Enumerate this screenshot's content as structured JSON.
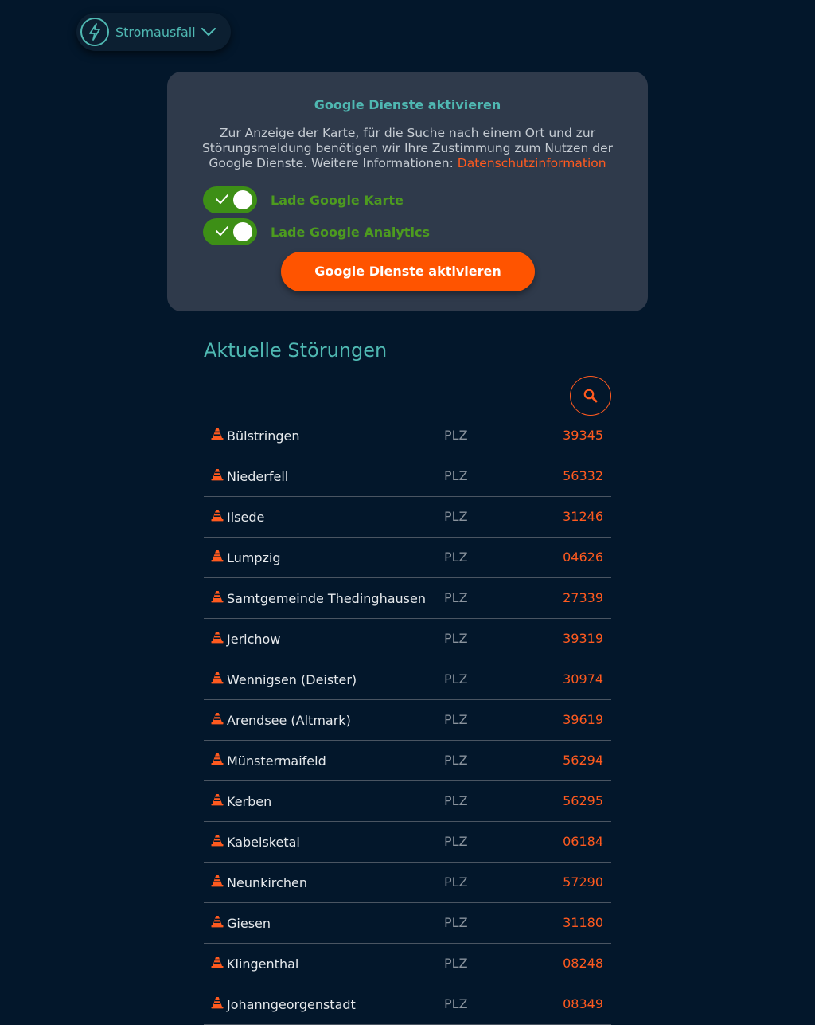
{
  "nav": {
    "selector_label": "Stromausfall",
    "selector_icon": "lightning-bolt-icon",
    "dropdown_icon": "chevron-down-icon"
  },
  "consent": {
    "title": "Google Dienste aktivieren",
    "text": "Zur Anzeige der Karte, für die Suche nach einem Ort und zur Störungsmeldung benötigen wir Ihre Zustimmung zum Nutzen der Google Dienste. Weitere Informationen: ",
    "link_label": "Datenschutzinformation",
    "toggles": [
      {
        "label": "Lade Google Karte",
        "checked": true
      },
      {
        "label": "Lade Google Analytics",
        "checked": true
      }
    ],
    "button_label": "Google Dienste aktivieren"
  },
  "outages": {
    "title": "Aktuelle Störungen",
    "search_icon": "search-icon",
    "row_icon": "traffic-cone-icon",
    "items": [
      {
        "city": "Bülstringen",
        "plz_label": "PLZ",
        "plz": "39345"
      },
      {
        "city": "Niederfell",
        "plz_label": "PLZ",
        "plz": "56332"
      },
      {
        "city": "Ilsede",
        "plz_label": "PLZ",
        "plz": "31246"
      },
      {
        "city": "Lumpzig",
        "plz_label": "PLZ",
        "plz": "04626"
      },
      {
        "city": "Samtgemeinde Thedinghausen",
        "plz_label": "PLZ",
        "plz": "27339"
      },
      {
        "city": "Jerichow",
        "plz_label": "PLZ",
        "plz": "39319"
      },
      {
        "city": "Wennigsen (Deister)",
        "plz_label": "PLZ",
        "plz": "30974"
      },
      {
        "city": "Arendsee (Altmark)",
        "plz_label": "PLZ",
        "plz": "39619"
      },
      {
        "city": "Münstermaifeld",
        "plz_label": "PLZ",
        "plz": "56294"
      },
      {
        "city": "Kerben",
        "plz_label": "PLZ",
        "plz": "56295"
      },
      {
        "city": "Kabelsketal",
        "plz_label": "PLZ",
        "plz": "06184"
      },
      {
        "city": "Neunkirchen",
        "plz_label": "PLZ",
        "plz": "57290"
      },
      {
        "city": "Giesen",
        "plz_label": "PLZ",
        "plz": "31180"
      },
      {
        "city": "Klingenthal",
        "plz_label": "PLZ",
        "plz": "08248"
      },
      {
        "city": "Johanngeorgenstadt",
        "plz_label": "PLZ",
        "plz": "08349"
      }
    ]
  },
  "colors": {
    "background": "#03172b",
    "teal_accent": "#4fb8b2",
    "orange_accent": "#ff5a1f",
    "toggle_green": "#3d8f16",
    "panel": "#2f3a4b"
  }
}
